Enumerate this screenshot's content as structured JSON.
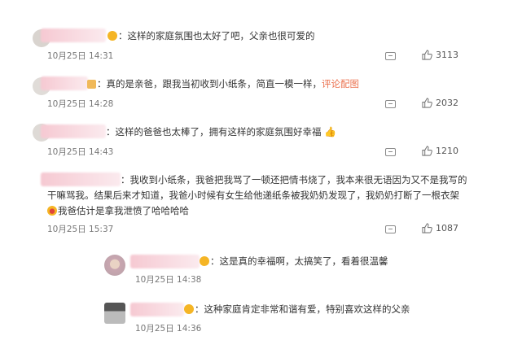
{
  "comments": [
    {
      "text": "：这样的家庭氛围也太好了吧，父亲也很可爱的",
      "time": "10月25日 14:31",
      "likes": "3113"
    },
    {
      "text": "：真的是亲爸，跟我当初收到小纸条，简直一模一样，",
      "link": "评论配图",
      "time": "10月25日 14:28",
      "likes": "2032"
    },
    {
      "text": "：这样的爸爸也太棒了，拥有这样的家庭氛围好幸福",
      "time": "10月25日 14:43",
      "likes": "1210"
    },
    {
      "text_a": "：我收到小纸条，我爸把我骂了一顿还把情书烧了，我本来很无语因为又不是我写的干嘛骂我。结果后来才知道，我爸小时候有女生给他递纸条被我奶奶发现了，我奶奶打断了一根衣架",
      "text_b": "我爸估计是拿我泄愤了哈哈哈哈",
      "time": "10月25日 15:37",
      "likes": "1087"
    }
  ],
  "replies": [
    {
      "text": "：这是真的幸福啊，太搞笑了，看着很温馨",
      "time": "10月25日 14:38"
    },
    {
      "text": "：这种家庭肯定非常和谐有爱，特别喜欢这样的父亲",
      "time": "10月25日 14:36"
    }
  ],
  "icons": {
    "reply": "reply-icon",
    "like": "thumbs-up-icon"
  },
  "colors": {
    "link": "#eb7350",
    "time": "#777777"
  }
}
